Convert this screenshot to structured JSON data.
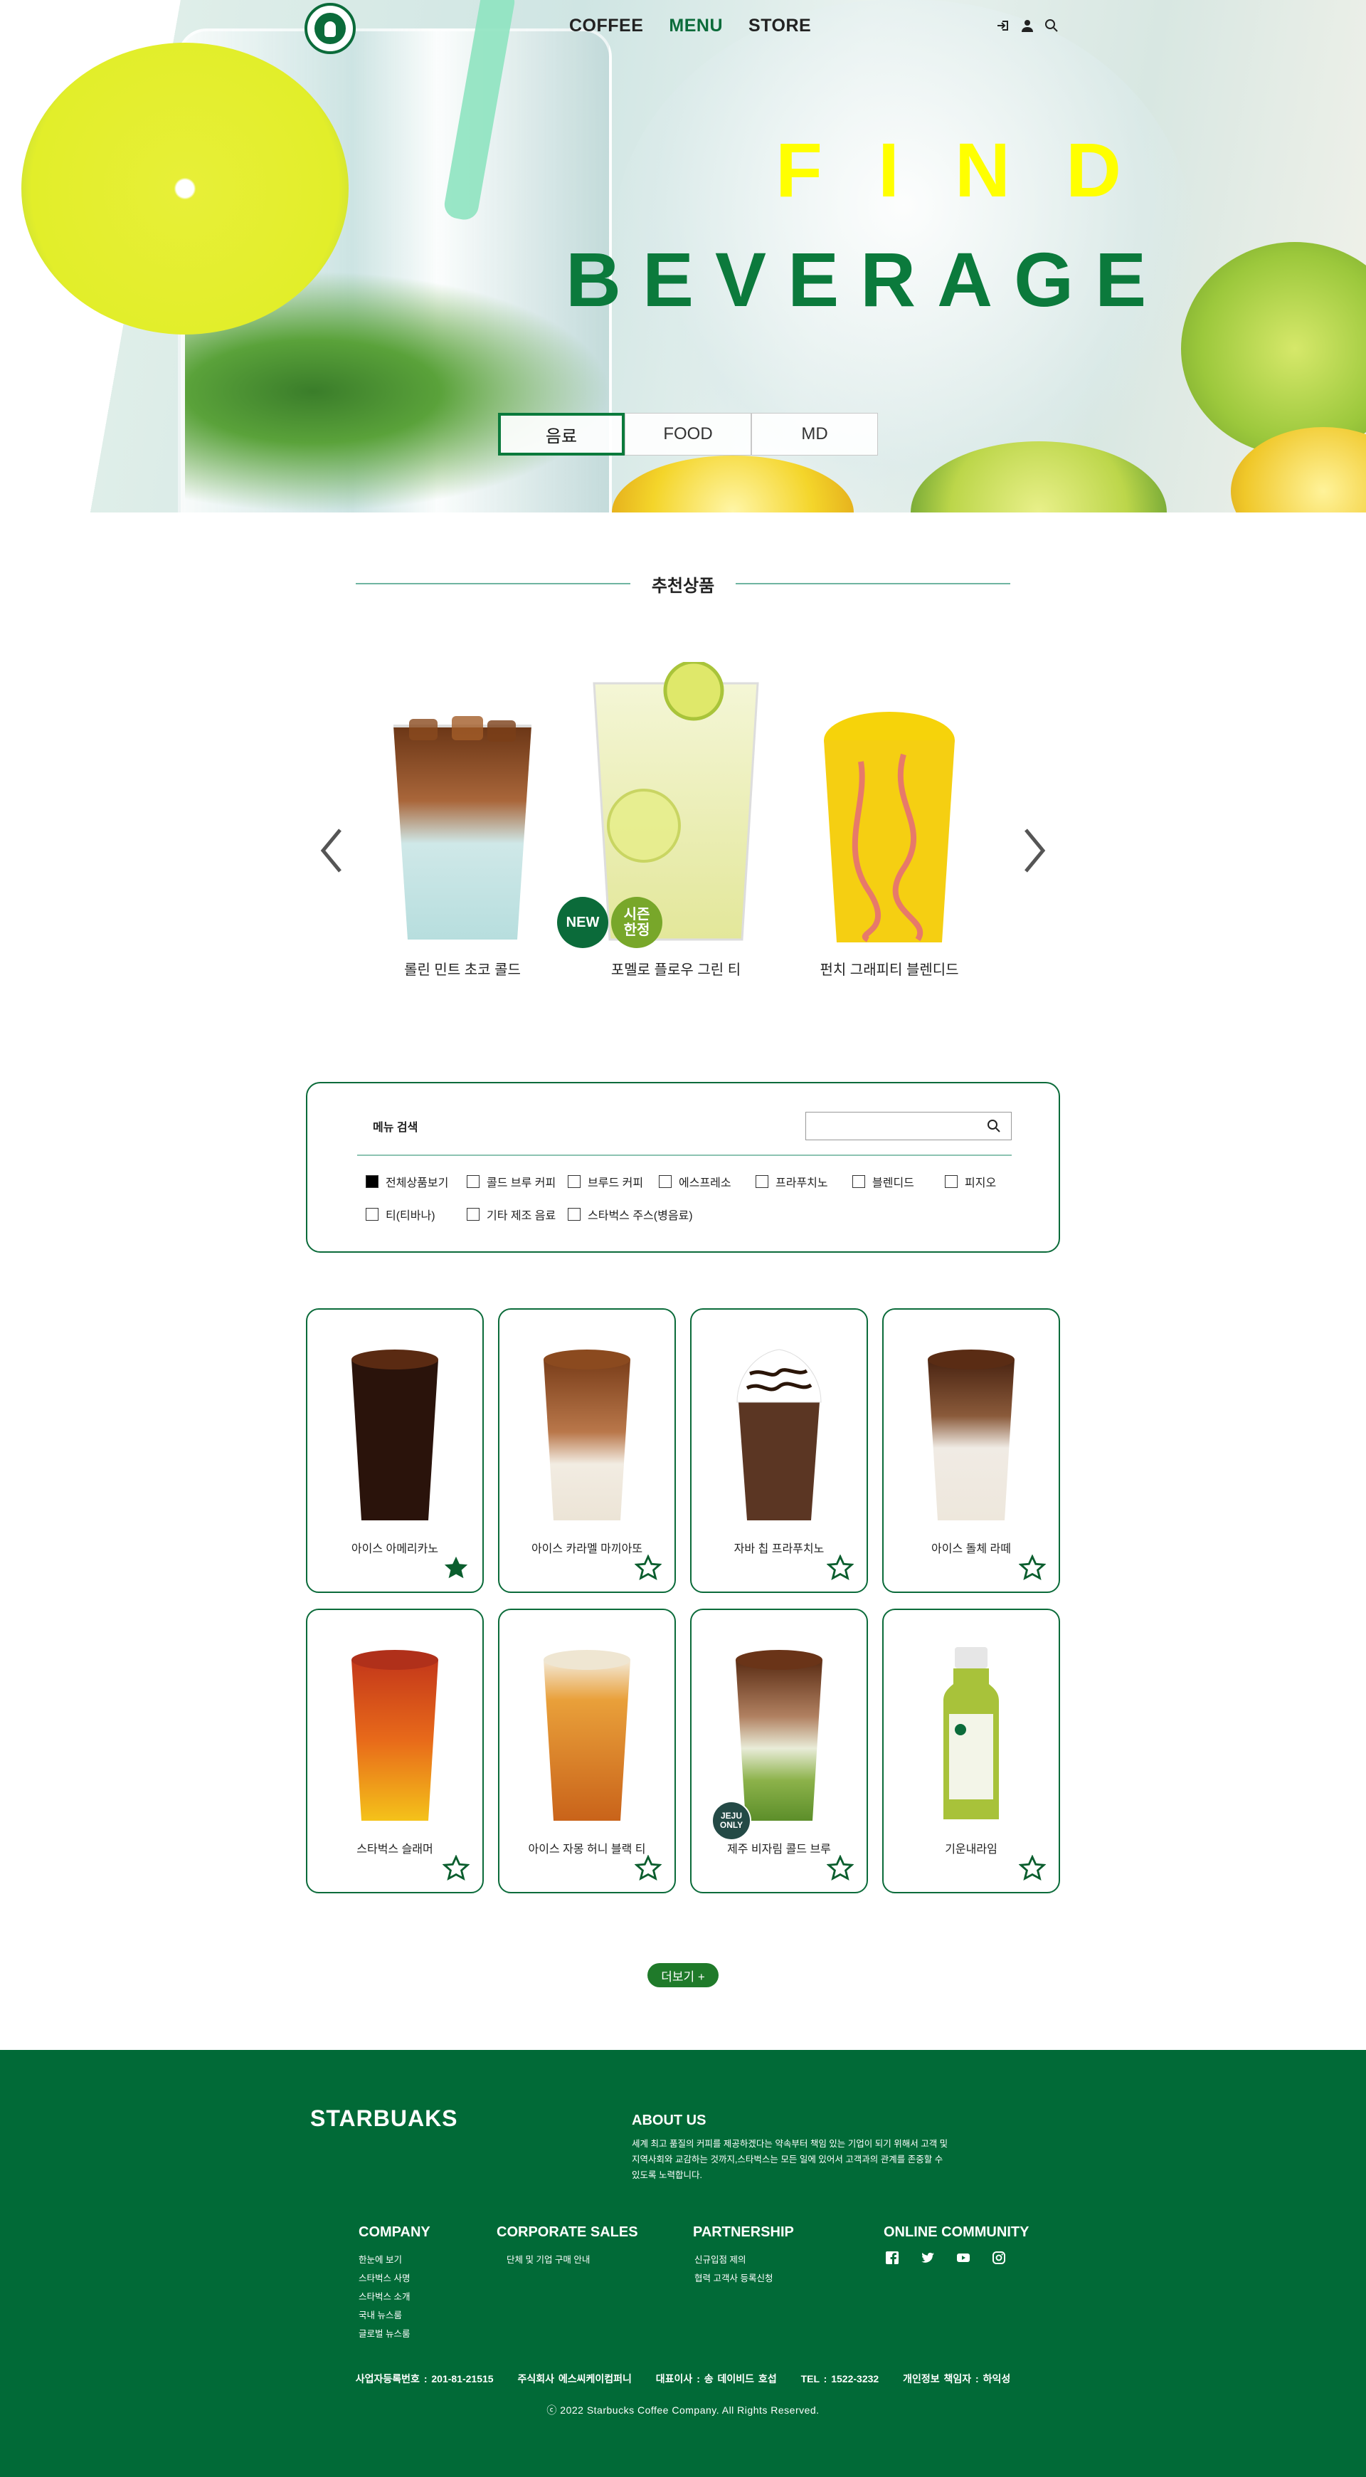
{
  "nav": {
    "items": [
      "COFFEE",
      "MENU",
      "STORE"
    ],
    "active": "MENU"
  },
  "hero": {
    "line1": "FIND",
    "line2": "BEVERAGE",
    "tabs": [
      "음료",
      "FOOD",
      "MD"
    ]
  },
  "recommend": {
    "title": "추천상품",
    "items": [
      {
        "name": "롤린 민트 초코 콜드"
      },
      {
        "name": "포멜로 플로우 그린 티",
        "badges": [
          "NEW",
          "시즌\n한정"
        ]
      },
      {
        "name": "펀치 그래피티 블렌디드"
      }
    ]
  },
  "search": {
    "label": "메뉴 검색",
    "placeholder": "",
    "categories": [
      {
        "label": "전체상품보기",
        "checked": true
      },
      {
        "label": "콜드 브루 커피",
        "checked": false
      },
      {
        "label": "브루드 커피",
        "checked": false
      },
      {
        "label": "에스프레소",
        "checked": false
      },
      {
        "label": "프라푸치노",
        "checked": false
      },
      {
        "label": "블렌디드",
        "checked": false
      },
      {
        "label": "피지오",
        "checked": false
      },
      {
        "label": "티(티바나)",
        "checked": false
      },
      {
        "label": "기타 제조 음료",
        "checked": false
      },
      {
        "label": "스타벅스 주스(병음료)",
        "checked": false
      }
    ]
  },
  "products": [
    {
      "name": "아이스 아메리카노",
      "favorite": true
    },
    {
      "name": "아이스 카라멜 마끼아또",
      "favorite": false
    },
    {
      "name": "자바 칩 프라푸치노",
      "favorite": false
    },
    {
      "name": "아이스 돌체 라떼",
      "favorite": false
    },
    {
      "name": "스타벅스 슬래머",
      "favorite": false
    },
    {
      "name": "아이스 자몽 허니 블랙 티",
      "favorite": false
    },
    {
      "name": "제주 비자림 콜드 브루",
      "favorite": false,
      "badge": "JEJU\nONLY"
    },
    {
      "name": "기운내라임",
      "favorite": false
    }
  ],
  "more_label": "더보기 +",
  "footer": {
    "brand": "STARBUAKS",
    "about_title": "ABOUT US",
    "about_text": "세계 최고 품질의 커피를 제공하겠다는 약속부터 책임 있는 기업이 되기 위해서 고객 및 지역사회와 교감하는 것까지,스타벅스는 모든 일에 있어서 고객과의 관계를 존중할 수 있도록 노력합니다.",
    "columns": [
      {
        "title": "COMPANY",
        "links": [
          "한눈에 보기",
          "스타벅스 사명",
          "스타벅스 소개",
          "국내 뉴스룸",
          "글로벌 뉴스룸"
        ]
      },
      {
        "title": "CORPORATE SALES",
        "links": [
          "단체 및 기업 구매 안내"
        ]
      },
      {
        "title": "PARTNERSHIP",
        "links": [
          "신규입점 제의",
          "협력 고객사 등록신청"
        ]
      },
      {
        "title": "ONLINE COMMUNITY",
        "links": []
      }
    ],
    "info": [
      "사업자등록번호 : 201-81-21515",
      "주식회사 에스씨케이컴퍼니",
      "대표이사 : 송 데이비드 호섭",
      "TEL : 1522-3232",
      "개인정보 책임자 : 하익성"
    ],
    "copyright": "ⓒ 2022 Starbucks Coffee Company. All Rights Reserved."
  },
  "colors": {
    "brand_green": "#016a37",
    "accent_yellow": "#ffff00",
    "beverage_green": "#0b7a3c"
  }
}
